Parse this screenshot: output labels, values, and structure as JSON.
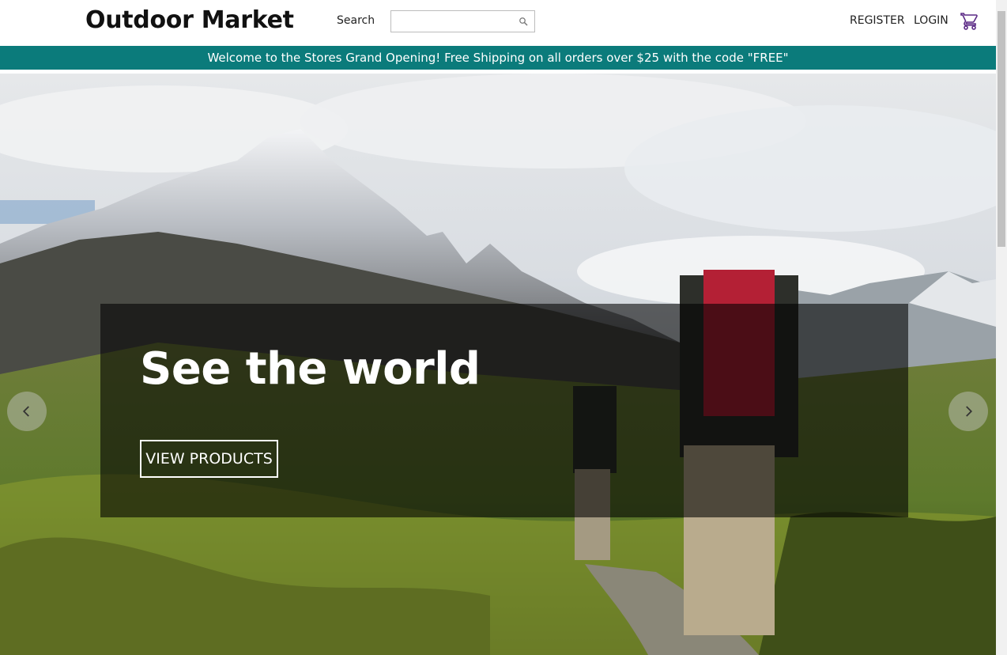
{
  "header": {
    "logo": "Outdoor Market",
    "search_label": "Search",
    "search_value": "",
    "search_placeholder": "",
    "register": "REGISTER",
    "login": "LOGIN"
  },
  "promo": {
    "text": "Welcome to the Stores Grand Opening! Free Shipping on all orders over $25 with the code \"FREE\""
  },
  "hero": {
    "title": "See the world",
    "button": "VIEW PRODUCTS"
  },
  "colors": {
    "promo_bg": "#0b7b7b",
    "cart_icon": "#5b2a86",
    "text": "#222222"
  },
  "icons": {
    "search": "search-icon",
    "cart": "shopping-cart-icon",
    "prev": "chevron-left-icon",
    "next": "chevron-right-icon"
  }
}
